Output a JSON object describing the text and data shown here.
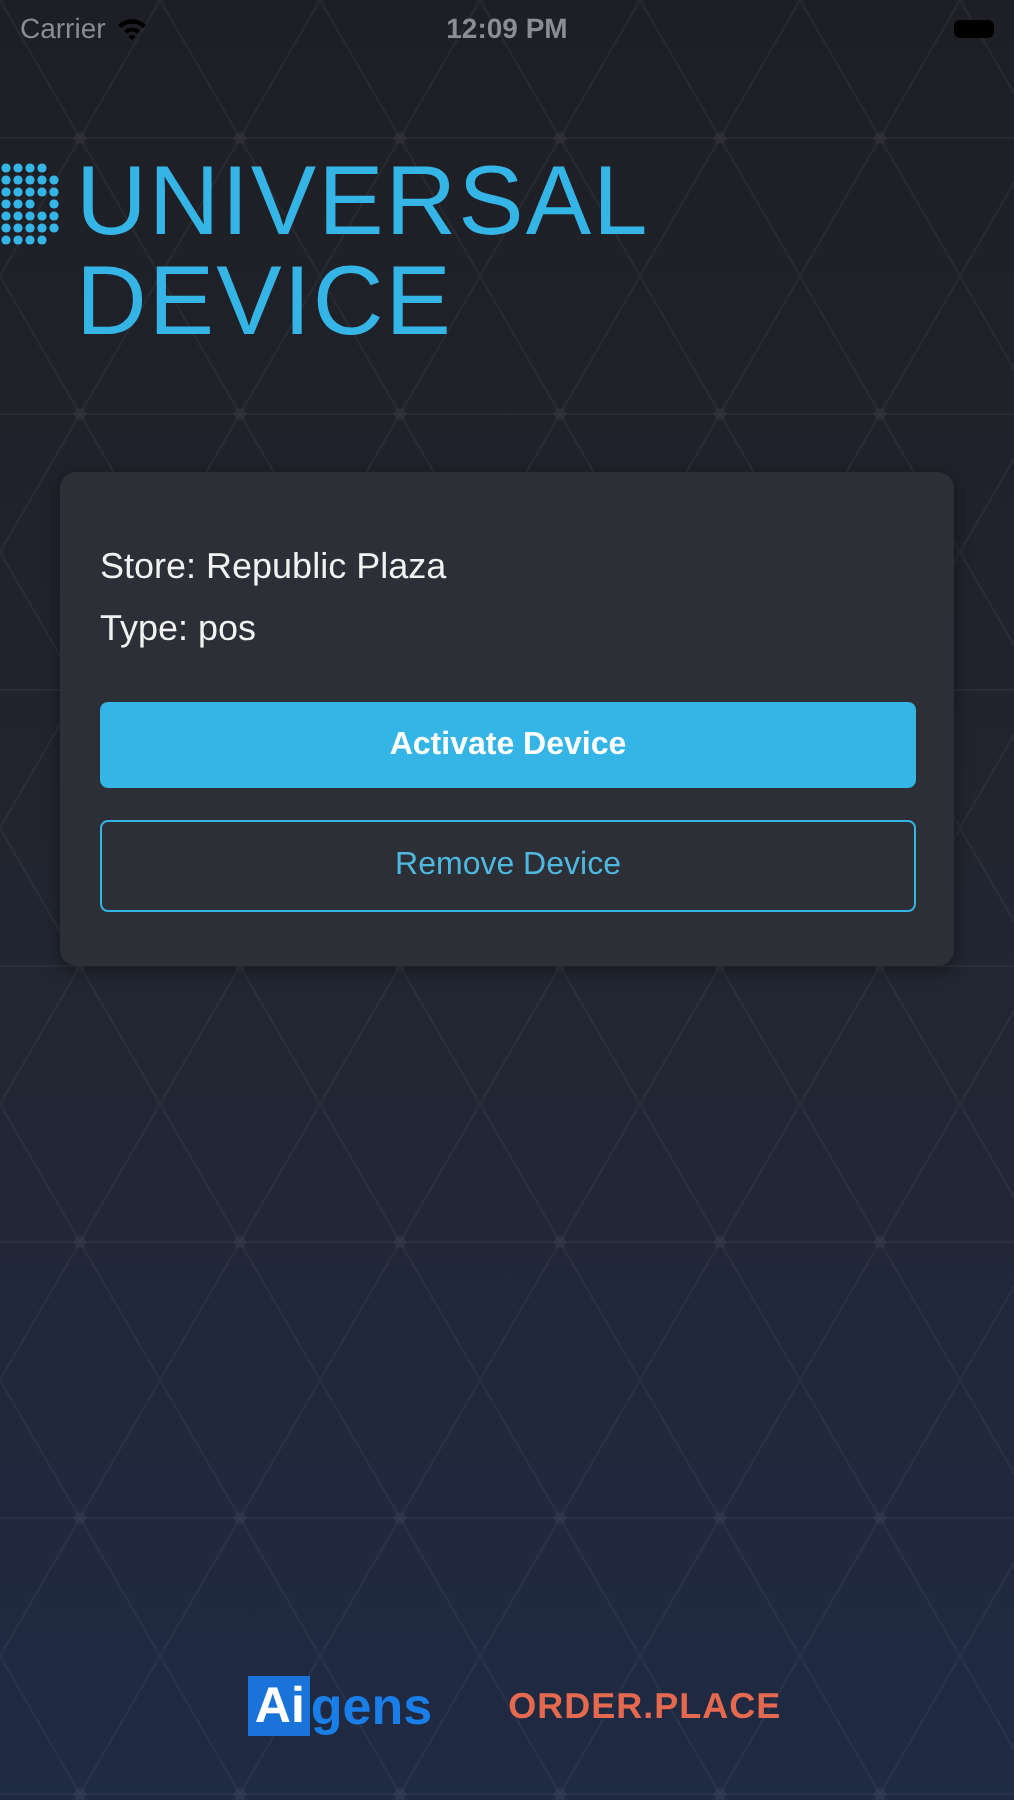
{
  "status_bar": {
    "carrier": "Carrier",
    "time": "12:09 PM"
  },
  "title": {
    "line_1": "UNIVERSAL",
    "line_2": "DEVICE"
  },
  "card": {
    "store": "Store: Republic Plaza",
    "type": "Type: pos",
    "buttons": [
      {
        "label": "Activate Device",
        "kind": "filled"
      },
      {
        "label": "Remove Device",
        "kind": "outlined"
      }
    ]
  },
  "footer": {
    "aigens_logo": {
      "boxed": "Ai",
      "rest": "gens"
    },
    "orderplace_logo": "ORDER.PLACE"
  }
}
